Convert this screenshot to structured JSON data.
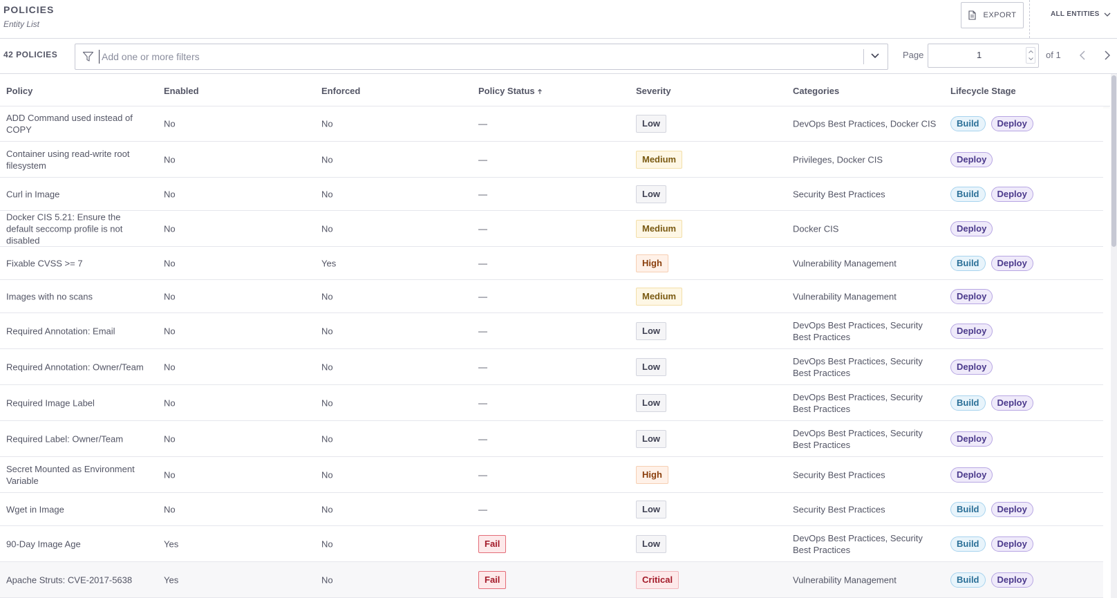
{
  "header": {
    "title": "POLICIES",
    "subtitle": "Entity List",
    "export_label": "EXPORT",
    "entities_label": "ALL ENTITIES"
  },
  "toolbar": {
    "count_label": "42 POLICIES",
    "search_placeholder": "Add one or more filters",
    "page_label": "Page",
    "page_value": "1",
    "of_label": "of 1"
  },
  "table": {
    "columns": [
      "Policy",
      "Enabled",
      "Enforced",
      "Policy Status",
      "Severity",
      "Categories",
      "Lifecycle Stage"
    ],
    "sort_indicator": "ascending",
    "rows": [
      {
        "policy": "ADD Command used instead of COPY",
        "enabled": "No",
        "enforced": "No",
        "status": "—",
        "severity": "Low",
        "categories": "DevOps Best Practices, Docker CIS",
        "lifecycle": [
          "Build",
          "Deploy"
        ]
      },
      {
        "policy": "Container using read-write root filesystem",
        "enabled": "No",
        "enforced": "No",
        "status": "—",
        "severity": "Medium",
        "categories": "Privileges, Docker CIS",
        "lifecycle": [
          "Deploy"
        ]
      },
      {
        "policy": "Curl in Image",
        "enabled": "No",
        "enforced": "No",
        "status": "—",
        "severity": "Low",
        "categories": "Security Best Practices",
        "lifecycle": [
          "Build",
          "Deploy"
        ]
      },
      {
        "policy": "Docker CIS 5.21: Ensure the default seccomp profile is not disabled",
        "enabled": "No",
        "enforced": "No",
        "status": "—",
        "severity": "Medium",
        "categories": "Docker CIS",
        "lifecycle": [
          "Deploy"
        ]
      },
      {
        "policy": "Fixable CVSS >= 7",
        "enabled": "No",
        "enforced": "Yes",
        "status": "—",
        "severity": "High",
        "categories": "Vulnerability Management",
        "lifecycle": [
          "Build",
          "Deploy"
        ]
      },
      {
        "policy": "Images with no scans",
        "enabled": "No",
        "enforced": "No",
        "status": "—",
        "severity": "Medium",
        "categories": "Vulnerability Management",
        "lifecycle": [
          "Deploy"
        ]
      },
      {
        "policy": "Required Annotation: Email",
        "enabled": "No",
        "enforced": "No",
        "status": "—",
        "severity": "Low",
        "categories": "DevOps Best Practices, Security Best Practices",
        "lifecycle": [
          "Deploy"
        ]
      },
      {
        "policy": "Required Annotation: Owner/Team",
        "enabled": "No",
        "enforced": "No",
        "status": "—",
        "severity": "Low",
        "categories": "DevOps Best Practices, Security Best Practices",
        "lifecycle": [
          "Deploy"
        ]
      },
      {
        "policy": "Required Image Label",
        "enabled": "No",
        "enforced": "No",
        "status": "—",
        "severity": "Low",
        "categories": "DevOps Best Practices, Security Best Practices",
        "lifecycle": [
          "Build",
          "Deploy"
        ]
      },
      {
        "policy": "Required Label: Owner/Team",
        "enabled": "No",
        "enforced": "No",
        "status": "—",
        "severity": "Low",
        "categories": "DevOps Best Practices, Security Best Practices",
        "lifecycle": [
          "Deploy"
        ]
      },
      {
        "policy": "Secret Mounted as Environment Variable",
        "enabled": "No",
        "enforced": "No",
        "status": "—",
        "severity": "High",
        "categories": "Security Best Practices",
        "lifecycle": [
          "Deploy"
        ]
      },
      {
        "policy": "Wget in Image",
        "enabled": "No",
        "enforced": "No",
        "status": "—",
        "severity": "Low",
        "categories": "Security Best Practices",
        "lifecycle": [
          "Build",
          "Deploy"
        ]
      },
      {
        "policy": "90-Day Image Age",
        "enabled": "Yes",
        "enforced": "No",
        "status": "Fail",
        "severity": "Low",
        "categories": "DevOps Best Practices, Security Best Practices",
        "lifecycle": [
          "Build",
          "Deploy"
        ]
      },
      {
        "policy": "Apache Struts: CVE-2017-5638",
        "enabled": "Yes",
        "enforced": "No",
        "status": "Fail",
        "severity": "Critical",
        "categories": "Vulnerability Management",
        "lifecycle": [
          "Build",
          "Deploy"
        ],
        "highlighted": true
      }
    ]
  },
  "colors": {
    "text": "#535565",
    "border": "#d9dbe3",
    "build_pill": "#e8f4fb",
    "deploy_pill": "#efeafa",
    "fail": "#a21a29"
  },
  "icons": {
    "export": "document-icon",
    "entities": "chevron-down-icon",
    "filter": "funnel-icon",
    "search_toggle": "chevron-down-icon",
    "prev": "chevron-left-icon",
    "next": "chevron-right-icon",
    "sort": "arrow-up-icon"
  }
}
